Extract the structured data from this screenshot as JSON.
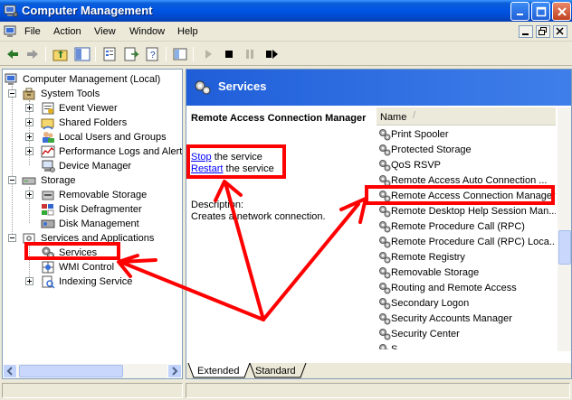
{
  "window": {
    "title": "Computer Management",
    "icon": "computer-management-icon",
    "controls": [
      "minimize-icon",
      "maximize-icon",
      "close-icon"
    ]
  },
  "menubar": {
    "items": [
      "File",
      "Action",
      "View",
      "Window",
      "Help"
    ]
  },
  "toolbar": {
    "buttons": [
      "back-arrow-icon",
      "forward-arrow-icon",
      "up-folder-icon",
      "show-hide-tree-icon",
      "properties-icon",
      "export-list-icon",
      "help-icon",
      "console-icon",
      "play-icon",
      "stop-icon",
      "pause-icon",
      "restart-icon"
    ]
  },
  "tree": {
    "root": "Computer Management (Local)",
    "system_tools": "System Tools",
    "event_viewer": "Event Viewer",
    "shared_folders": "Shared Folders",
    "local_users": "Local Users and Groups",
    "perf_logs": "Performance Logs and Alert",
    "device_manager": "Device Manager",
    "storage": "Storage",
    "removable_storage": "Removable Storage",
    "disk_defrag": "Disk Defragmenter",
    "disk_management": "Disk Management",
    "services_apps": "Services and Applications",
    "services": "Services",
    "wmi_control": "WMI Control",
    "indexing_service": "Indexing Service"
  },
  "services_header": {
    "title": "Services"
  },
  "details": {
    "service_title": "Remote Access Connection Manager",
    "stop_link": "Stop",
    "stop_rest": " the service",
    "restart_link": "Restart",
    "restart_rest": " the service",
    "description_label": "Description:",
    "description_text": "Creates a network connection."
  },
  "list": {
    "column_name": "Name",
    "sort_glyph": "/",
    "rows": [
      "Print Spooler",
      "Protected Storage",
      "QoS RSVP",
      "Remote Access Auto Connection ...",
      "Remote Access Connection Manager",
      "Remote Desktop Help Session Man...",
      "Remote Procedure Call (RPC)",
      "Remote Procedure Call (RPC) Loca...",
      "Remote Registry",
      "Removable Storage",
      "Routing and Remote Access",
      "Secondary Logon",
      "Security Accounts Manager",
      "Security Center",
      "S"
    ],
    "selected_index": 4
  },
  "tabs": {
    "extended": "Extended",
    "standard": "Standard",
    "active": "Extended"
  },
  "colors": {
    "titlebar": "#0054e3",
    "annotation_red": "#ff0000",
    "link_blue": "#0000ff"
  }
}
